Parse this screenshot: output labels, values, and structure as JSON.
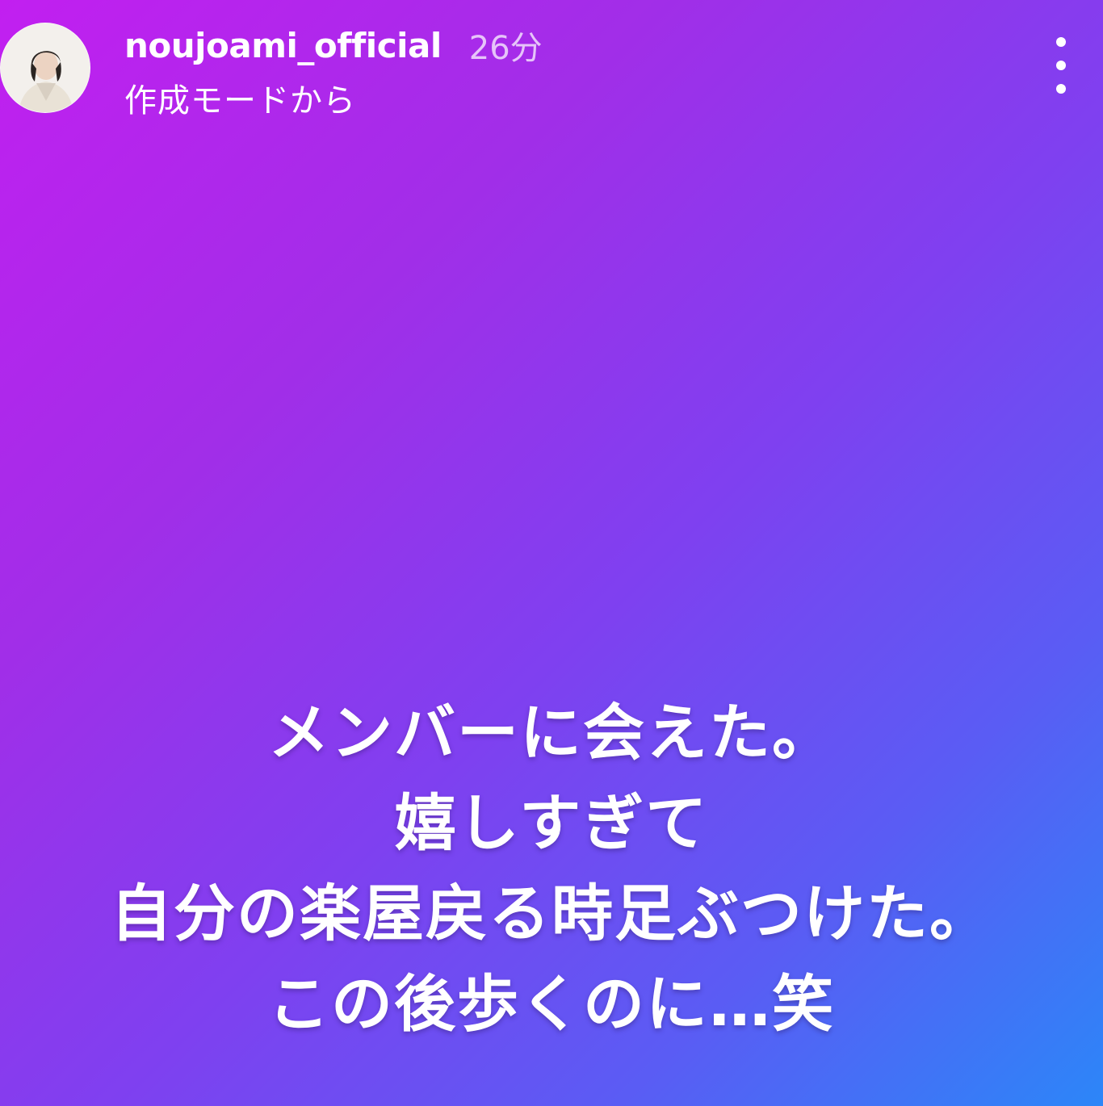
{
  "header": {
    "username": "noujoami_official",
    "time_ago": "26分",
    "subtitle": "作成モードから",
    "more_icon": "more-vertical-icon"
  },
  "story": {
    "lines": [
      "メンバーに会えた。",
      "嬉しすぎて",
      "自分の楽屋戻る時足ぶつけた。",
      "この後歩くのに…笑"
    ]
  },
  "colors": {
    "gradient_start": "#c21ff0",
    "gradient_mid": "#7f40f0",
    "gradient_end": "#2c86f8",
    "text": "#ffffff"
  }
}
